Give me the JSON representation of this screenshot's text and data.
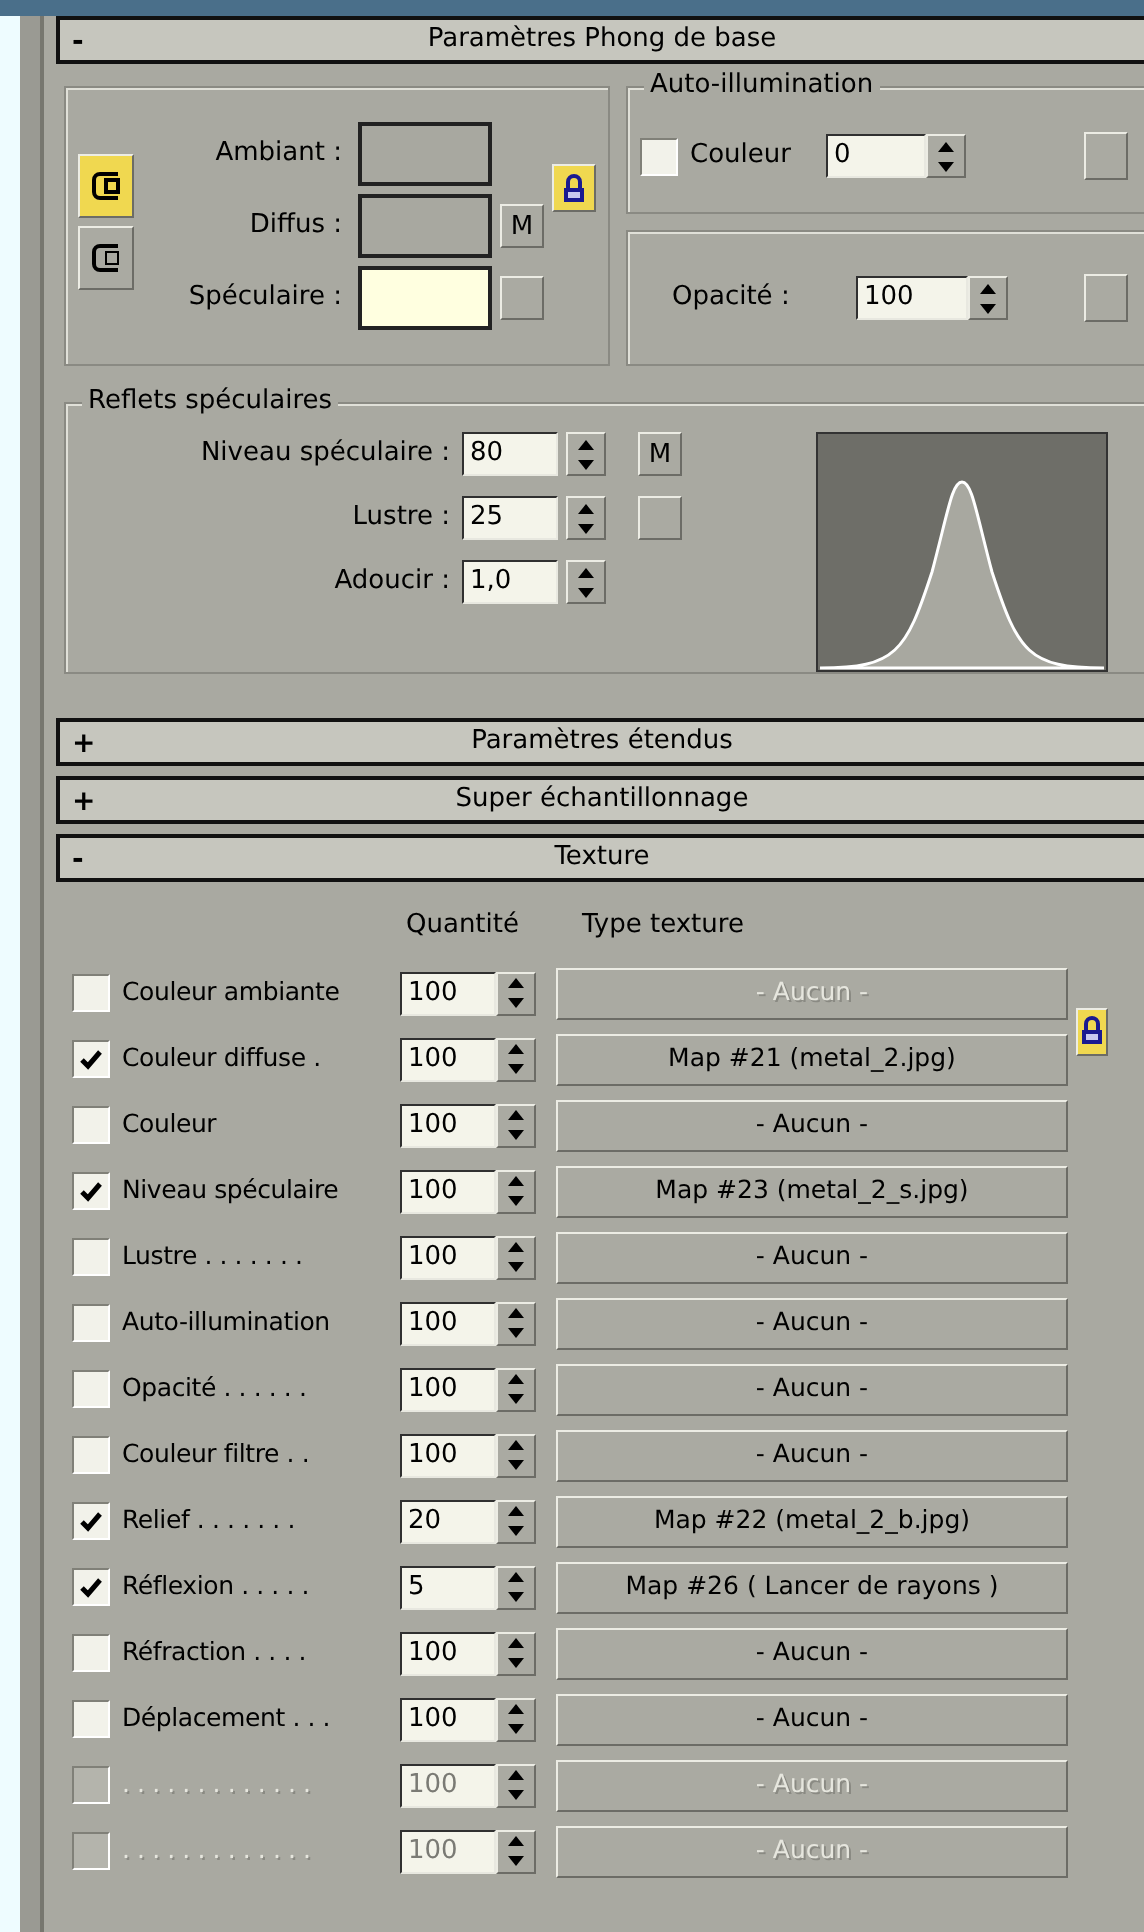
{
  "basic_rollout": {
    "toggle": "-",
    "title": "Paramètres Phong de base"
  },
  "swatch_modes": [
    {
      "selected": true
    },
    {
      "selected": false
    }
  ],
  "colors": [
    {
      "label": "Ambiant :",
      "color": "#a8a8a0",
      "kind": "none"
    },
    {
      "label": "Diffus :",
      "color": "#a8a8a0",
      "kind": "labeled",
      "map_label": "M"
    },
    {
      "label": "Spéculaire :",
      "color": "#ffffe0",
      "kind": "blank"
    }
  ],
  "color_lock": {
    "on": true
  },
  "auto_illumination": {
    "title": "Auto-illumination",
    "checkbox_label": "Couleur",
    "checked": false,
    "value": "0"
  },
  "opacity": {
    "label": "Opacité :",
    "value": "100"
  },
  "specular_highlights": {
    "title": "Reflets spéculaires",
    "rows": [
      {
        "label": "Niveau spéculaire :",
        "value": "80",
        "kind": "labeled",
        "map_label": "M"
      },
      {
        "label": "Lustre :",
        "value": "25",
        "kind": "blank"
      },
      {
        "label": "Adoucir :",
        "value": "1,0",
        "kind": "none"
      }
    ]
  },
  "rollouts": [
    {
      "toggle": "+",
      "title": "Paramètres étendus"
    },
    {
      "toggle": "+",
      "title": "Super échantillonnage"
    },
    {
      "toggle": "-",
      "title": "Texture"
    }
  ],
  "texture": {
    "columns": [
      "Quantité",
      "Type texture"
    ],
    "rows": [
      {
        "label": "Couleur ambiante",
        "checked": false,
        "disabled": false,
        "amount": "100",
        "map": "- Aucun -",
        "map_disabled": true
      },
      {
        "label": "Couleur diffuse .",
        "checked": true,
        "disabled": false,
        "amount": "100",
        "map": "Map #21 (metal_2.jpg)",
        "map_disabled": false
      },
      {
        "label": "Couleur",
        "checked": false,
        "disabled": false,
        "amount": "100",
        "map": "- Aucun -",
        "map_disabled": false
      },
      {
        "label": "Niveau spéculaire",
        "checked": true,
        "disabled": false,
        "amount": "100",
        "map": "Map #23 (metal_2_s.jpg)",
        "map_disabled": false
      },
      {
        "label": "Lustre . . . . . . .",
        "checked": false,
        "disabled": false,
        "amount": "100",
        "map": "- Aucun -",
        "map_disabled": false
      },
      {
        "label": "Auto-illumination",
        "checked": false,
        "disabled": false,
        "amount": "100",
        "map": "- Aucun -",
        "map_disabled": false
      },
      {
        "label": "Opacité . . . . . .",
        "checked": false,
        "disabled": false,
        "amount": "100",
        "map": "- Aucun -",
        "map_disabled": false
      },
      {
        "label": "Couleur filtre . .",
        "checked": false,
        "disabled": false,
        "amount": "100",
        "map": "- Aucun -",
        "map_disabled": false
      },
      {
        "label": "Relief . . . . . . .",
        "checked": true,
        "disabled": false,
        "amount": "20",
        "map": "Map #22 (metal_2_b.jpg)",
        "map_disabled": false
      },
      {
        "label": "Réflexion . . . . .",
        "checked": true,
        "disabled": false,
        "amount": "5",
        "map": "Map #26  ( Lancer de rayons )",
        "map_disabled": false
      },
      {
        "label": "Réfraction . . . .",
        "checked": false,
        "disabled": false,
        "amount": "100",
        "map": "- Aucun -",
        "map_disabled": false
      },
      {
        "label": "Déplacement . . .",
        "checked": false,
        "disabled": false,
        "amount": "100",
        "map": "- Aucun -",
        "map_disabled": false
      },
      {
        "label": ". . . . . . . . . . . . .",
        "checked": false,
        "disabled": true,
        "amount": "100",
        "map": "- Aucun -",
        "map_disabled": true
      },
      {
        "label": ". . . . . . . . . . . . .",
        "checked": false,
        "disabled": true,
        "amount": "100",
        "map": "- Aucun -",
        "map_disabled": true
      }
    ]
  }
}
